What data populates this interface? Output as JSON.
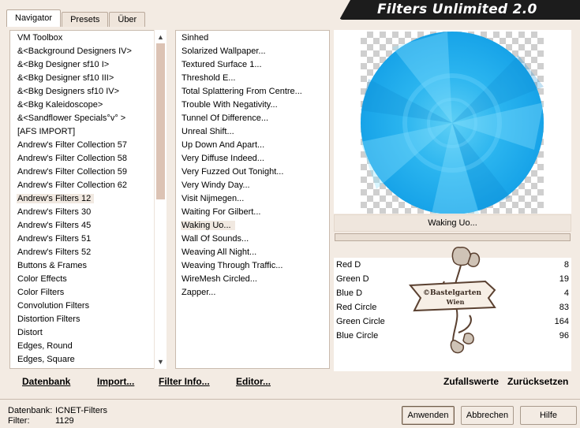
{
  "app": {
    "title": "Filters Unlimited 2.0"
  },
  "tabs": [
    {
      "label": "Navigator",
      "active": true
    },
    {
      "label": "Presets",
      "active": false
    },
    {
      "label": "Über",
      "active": false
    }
  ],
  "categories": {
    "selected": "Andrew's Filters 12",
    "items": [
      "VM Toolbox",
      "&<Background Designers IV>",
      "&<Bkg Designer sf10 I>",
      "&<Bkg Designer sf10 III>",
      "&<Bkg Designers sf10 IV>",
      "&<Bkg Kaleidoscope>",
      "&<Sandflower Specials°v° >",
      "[AFS IMPORT]",
      "Andrew's Filter Collection 57",
      "Andrew's Filter Collection 58",
      "Andrew's Filter Collection 59",
      "Andrew's Filter Collection 62",
      "Andrew's Filters 12",
      "Andrew's Filters 30",
      "Andrew's Filters 45",
      "Andrew's Filters 51",
      "Andrew's Filters 52",
      "Buttons & Frames",
      "Color Effects",
      "Color Filters",
      "Convolution Filters",
      "Distortion Filters",
      "Distort",
      "Edges, Round",
      "Edges, Square"
    ]
  },
  "filters": {
    "selected": "Waking Uo...",
    "items": [
      "Sinhed",
      "Solarized Wallpaper...",
      "Textured Surface 1...",
      "Threshold E...",
      "Total Splattering From Centre...",
      "Trouble With Negativity...",
      "Tunnel Of Difference...",
      "Unreal Shift...",
      "Up Down And Apart...",
      "Very Diffuse Indeed...",
      "Very Fuzzed Out Tonight...",
      "Very Windy Day...",
      "Visit Nijmegen...",
      "Waiting For Gilbert...",
      "Waking Uo...",
      "Wall Of Sounds...",
      "Weaving All Night...",
      "Weaving Through Traffic...",
      "WireMesh Circled...",
      "Zapper..."
    ]
  },
  "preview": {
    "filter_name": "Waking Uo...",
    "accent": "#2ab4ef"
  },
  "parameters": [
    {
      "label": "Red D",
      "value": "8"
    },
    {
      "label": "Green D",
      "value": "19"
    },
    {
      "label": "Blue D",
      "value": "4"
    },
    {
      "label": "Red Circle",
      "value": "83"
    },
    {
      "label": "Green Circle",
      "value": "164"
    },
    {
      "label": "Blue Circle",
      "value": "96"
    }
  ],
  "watermark": {
    "line1": "©Bastelgarten",
    "line2": "Wien"
  },
  "actions": {
    "datenbank": "Datenbank",
    "import": "Import...",
    "filter_info": "Filter Info...",
    "editor": "Editor...",
    "random": "Zufallswerte",
    "reset": "Zurücksetzen"
  },
  "status": {
    "db_label": "Datenbank:",
    "db_value": "ICNET-Filters",
    "filter_label": "Filter:",
    "filter_value": "1129"
  },
  "buttons": {
    "apply": "Anwenden",
    "cancel": "Abbrechen",
    "help": "Hilfe"
  }
}
